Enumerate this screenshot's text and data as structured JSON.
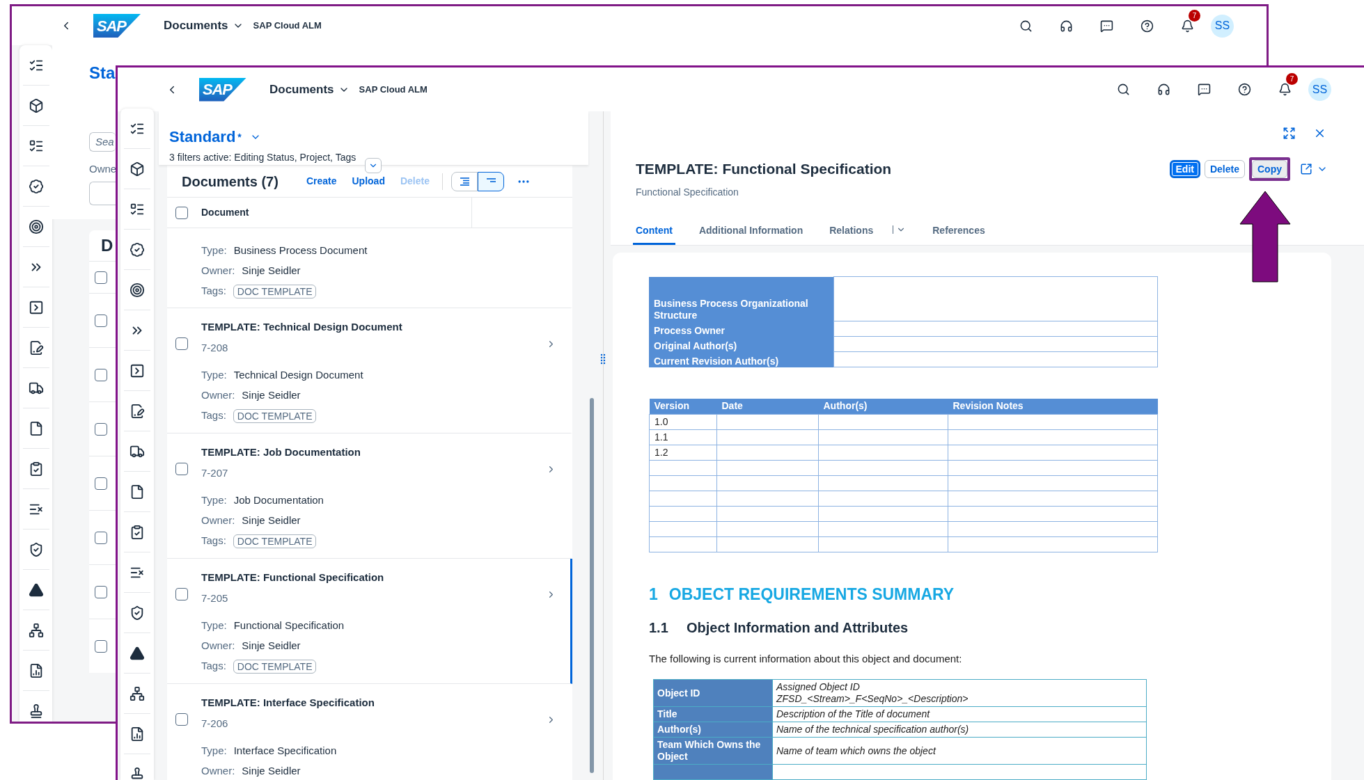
{
  "back_window": {
    "header": {
      "logo": "SAP",
      "app_title": "Documents",
      "product": "SAP Cloud ALM",
      "notifications": "7",
      "avatar": "SS"
    },
    "variant": "Sta",
    "search": {
      "placeholder": "Sea"
    },
    "filter_label": "Owne",
    "table_title": "D",
    "header_checkbox": {
      "checked": false
    },
    "rows": [
      {
        "checked": false
      },
      {
        "checked": false
      },
      {
        "checked": false
      },
      {
        "checked": false
      },
      {
        "checked": false
      },
      {
        "checked": false
      },
      {
        "checked": false
      }
    ]
  },
  "front_window": {
    "header": {
      "logo": "SAP",
      "app_title": "Documents",
      "product": "SAP Cloud ALM",
      "notifications": "7",
      "avatar": "SS"
    },
    "list": {
      "variant": "Standard",
      "variant_modified": "*",
      "filter_summary": "3 filters active: Editing Status, Project, Tags",
      "title": "Documents (7)",
      "actions": [
        {
          "label": "Create",
          "disabled": false
        },
        {
          "label": "Upload",
          "disabled": false
        },
        {
          "label": "Delete",
          "disabled": true
        }
      ],
      "view_toggle": [
        {
          "selected": false
        },
        {
          "selected": true
        }
      ],
      "column": "Document",
      "header_checkbox": {
        "checked": false
      },
      "items": [
        {
          "selected": false,
          "fields": [
            {
              "kind": "text",
              "label": "Type:",
              "value": "Business Process Document"
            },
            {
              "kind": "text",
              "label": "Owner:",
              "value": "Sinje Seidler"
            },
            {
              "kind": "tag",
              "label": "Tags:",
              "value": "DOC TEMPLATE"
            }
          ]
        },
        {
          "title": "TEMPLATE: Technical Design Document",
          "id": "7-208",
          "checked": false,
          "selected": false,
          "fields": [
            {
              "kind": "text",
              "label": "Type:",
              "value": "Technical Design Document"
            },
            {
              "kind": "text",
              "label": "Owner:",
              "value": "Sinje Seidler"
            },
            {
              "kind": "tag",
              "label": "Tags:",
              "value": "DOC TEMPLATE"
            }
          ]
        },
        {
          "title": "TEMPLATE: Job Documentation",
          "id": "7-207",
          "checked": false,
          "selected": false,
          "fields": [
            {
              "kind": "text",
              "label": "Type:",
              "value": "Job Documentation"
            },
            {
              "kind": "text",
              "label": "Owner:",
              "value": "Sinje Seidler"
            },
            {
              "kind": "tag",
              "label": "Tags:",
              "value": "DOC TEMPLATE"
            }
          ]
        },
        {
          "title": "TEMPLATE: Functional Specification",
          "id": "7-205",
          "checked": false,
          "selected": true,
          "fields": [
            {
              "kind": "text",
              "label": "Type:",
              "value": "Functional Specification"
            },
            {
              "kind": "text",
              "label": "Owner:",
              "value": "Sinje Seidler"
            },
            {
              "kind": "tag",
              "label": "Tags:",
              "value": "DOC TEMPLATE"
            }
          ]
        },
        {
          "title": "TEMPLATE: Interface Specification",
          "id": "7-206",
          "checked": false,
          "selected": false,
          "fields": [
            {
              "kind": "text",
              "label": "Type:",
              "value": "Interface Specification"
            },
            {
              "kind": "text",
              "label": "Owner:",
              "value": "Sinje Seidler"
            }
          ]
        }
      ]
    },
    "detail": {
      "title": "TEMPLATE: Functional Specification",
      "subtitle": "Functional Specification",
      "actions": [
        {
          "label": "Edit",
          "kind": "emphasized",
          "highlighted": false
        },
        {
          "label": "Delete",
          "kind": "default",
          "highlighted": false
        },
        {
          "label": "Copy",
          "kind": "default",
          "highlighted": true
        }
      ],
      "tabs": [
        {
          "label": "Content",
          "selected": true,
          "has_menu": false
        },
        {
          "label": "Additional Information",
          "selected": false,
          "has_menu": false
        },
        {
          "label": "Relations",
          "selected": false,
          "has_menu": true
        },
        {
          "label": "References",
          "selected": false,
          "has_menu": false
        }
      ],
      "document": {
        "info_table": [
          "Business Process Organizational Structure",
          "Process Owner",
          "Original Author(s)",
          "Current Revision Author(s)"
        ],
        "revision_table": {
          "columns": [
            "Version",
            "Date",
            "Author(s)",
            "Revision Notes"
          ],
          "rows": [
            {
              "version": "1.0"
            },
            {
              "version": "1.1"
            },
            {
              "version": "1.2"
            }
          ]
        },
        "section": {
          "number": "1",
          "title": "OBJECT REQUIREMENTS SUMMARY"
        },
        "subsection": {
          "number": "1.1",
          "title": "Object Information and Attributes"
        },
        "intro": "The following is current information about this object and document:",
        "object_table": [
          {
            "label": "Object ID",
            "value": [
              "Assigned Object ID",
              "ZFSD_<Stream>_F<SeqNo>_<Description>"
            ]
          },
          {
            "label": "Title",
            "value": [
              "Description of the Title of document"
            ]
          },
          {
            "label": "Author(s)",
            "value": [
              "Name of the technical specification author(s)"
            ]
          },
          {
            "label": "Team Which Owns the Object",
            "value": [
              "Name of team which owns the object"
            ]
          }
        ]
      }
    }
  }
}
